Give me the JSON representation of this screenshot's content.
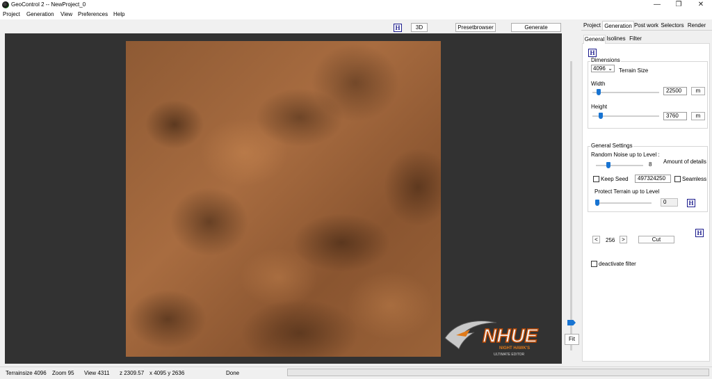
{
  "window": {
    "title": "GeoControl 2  --  NewProject_0",
    "minimize": "—",
    "maximize": "❐",
    "close": "✕"
  },
  "menu": [
    "Project",
    "Generation",
    "View",
    "Preferences",
    "Help"
  ],
  "toolbar": {
    "h_label": "H",
    "btn_3d": "3D",
    "presetbrowser": "Presetbrowser",
    "generate": "Generate",
    "fit": "Fit"
  },
  "main_tabs": [
    "Project",
    "Generation",
    "Post work",
    "Selectors",
    "Render"
  ],
  "sub_tabs": [
    "General",
    "Isolines",
    "Filter"
  ],
  "panel": {
    "h_label": "H",
    "dimensions": {
      "title": "Dimensions",
      "size_value": "4096",
      "size_label": "Terrain Size",
      "width_label": "Width",
      "width_value": "22500",
      "width_unit": "m",
      "height_label": "Height",
      "height_value": "3760",
      "height_unit": "m"
    },
    "general_settings": {
      "title": "General Settings",
      "noise_label": "Random Noise up to Level :",
      "noise_value": "8",
      "details_label": "Amount of details",
      "keep_seed_label": "Keep Seed",
      "seed_value": "497324250",
      "seamless_label": "Seamless",
      "protect_label": "Protect Terrain up to Level",
      "protect_value": "0"
    },
    "cut": {
      "prev": "<",
      "value": "256",
      "next": ">",
      "cut_label": "Cut"
    },
    "deactivate_label": "deactivate filter"
  },
  "status": {
    "terrainsize": "Terrainsize  4096",
    "zoom": "Zoom  95",
    "view": "View  4311",
    "z": "z 2309.57",
    "xy": "x 4095 y 2636",
    "state": "Done"
  },
  "logo": {
    "name": "NHUE",
    "tagline1": "NIGHT HAWK'S",
    "tagline2": "ULTIMATE EDITOR"
  },
  "colors": {
    "accent": "#1874d2",
    "viewport_bg": "#323232",
    "terrain": "#9a6238"
  }
}
